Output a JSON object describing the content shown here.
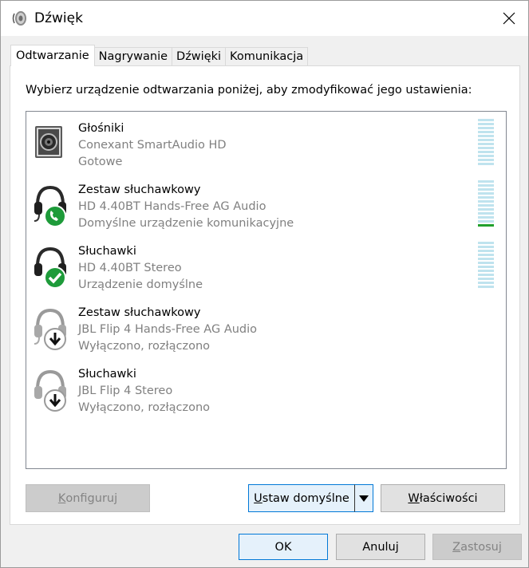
{
  "window": {
    "title": "Dźwięk"
  },
  "tabs": [
    {
      "label": "Odtwarzanie",
      "active": true
    },
    {
      "label": "Nagrywanie",
      "active": false
    },
    {
      "label": "Dźwięki",
      "active": false
    },
    {
      "label": "Komunikacja",
      "active": false
    }
  ],
  "instruction": "Wybierz urządzenie odtwarzania poniżej, aby zmodyfikować jego ustawienia:",
  "devices": [
    {
      "name": "Głośniki",
      "driver": "Conexant SmartAudio HD",
      "status": "Gotowe",
      "icon": "speaker-icon",
      "meter_level": 0
    },
    {
      "name": "Zestaw słuchawkowy",
      "driver": "HD 4.40BT Hands-Free AG Audio",
      "status": "Domyślne urządzenie komunikacyjne",
      "icon": "headset-phone-icon",
      "meter_level": 1
    },
    {
      "name": "Słuchawki",
      "driver": "HD 4.40BT Stereo",
      "status": "Urządzenie domyślne",
      "icon": "headphones-check-icon",
      "meter_level": 0
    },
    {
      "name": "Zestaw słuchawkowy",
      "driver": "JBL Flip 4 Hands-Free AG Audio",
      "status": "Wyłączono, rozłączono",
      "icon": "headset-disconnected-icon"
    },
    {
      "name": "Słuchawki",
      "driver": "JBL Flip 4 Stereo",
      "status": "Wyłączono, rozłączono",
      "icon": "headphones-disconnected-icon"
    }
  ],
  "buttons": {
    "configure": {
      "label_accel": "K",
      "label_rest": "onfiguruj"
    },
    "set_default": {
      "label_accel": "U",
      "label_rest": "staw domyślne"
    },
    "properties": {
      "label_accel": "W",
      "label_rest": "łaściwości"
    },
    "ok": "OK",
    "cancel": "Anuluj",
    "apply": {
      "label_accel": "Z",
      "label_rest": "astosuj"
    }
  },
  "colors": {
    "accent": "#0078d7",
    "meter_idle": "#bfe3ee",
    "meter_active": "#22a02c",
    "status_green": "#1e9b3a"
  }
}
